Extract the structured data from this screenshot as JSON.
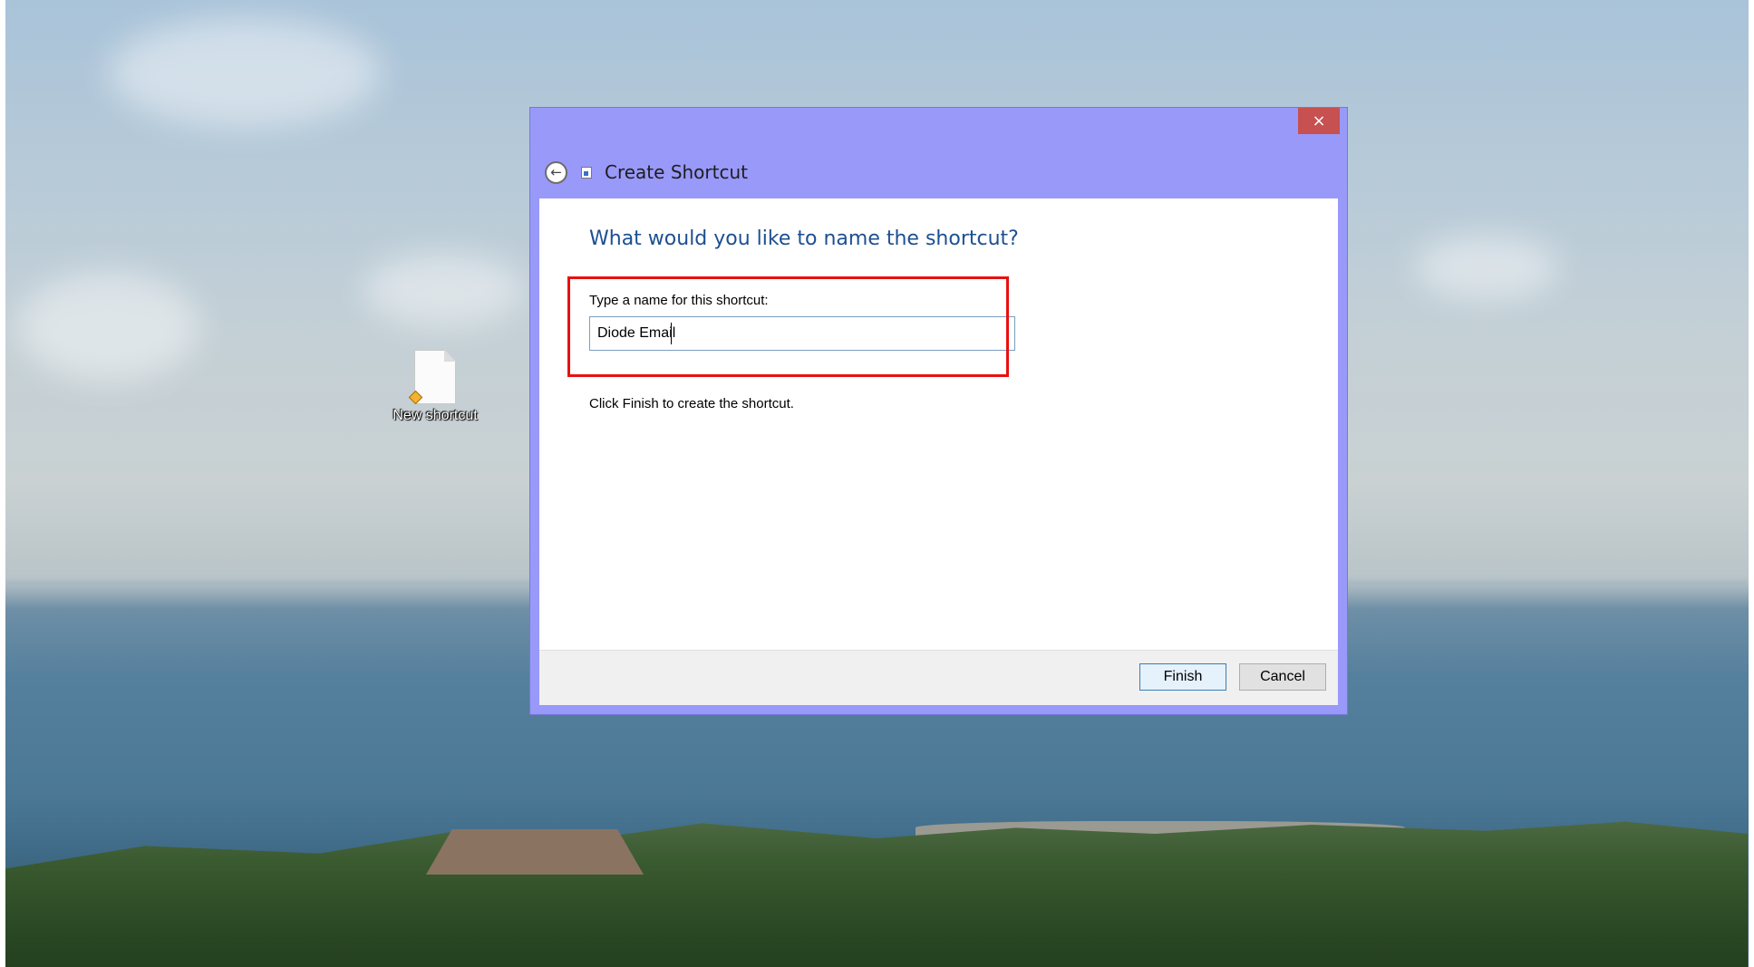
{
  "desktop": {
    "icons": [
      {
        "label": "New shortcut",
        "icon": "shortcut-file-icon"
      }
    ]
  },
  "dialog": {
    "title": "Create Shortcut",
    "close_label": "×",
    "back_label": "←",
    "heading": "What would you like to name the shortcut?",
    "field_label": "Type a name for this shortcut:",
    "name_value": "Diode Email",
    "hint": "Click Finish to create the shortcut.",
    "buttons": {
      "finish": "Finish",
      "cancel": "Cancel"
    }
  },
  "colors": {
    "frame": "#9999f9",
    "heading": "#1d4f91",
    "close": "#c75050",
    "highlight": "#e81010"
  }
}
